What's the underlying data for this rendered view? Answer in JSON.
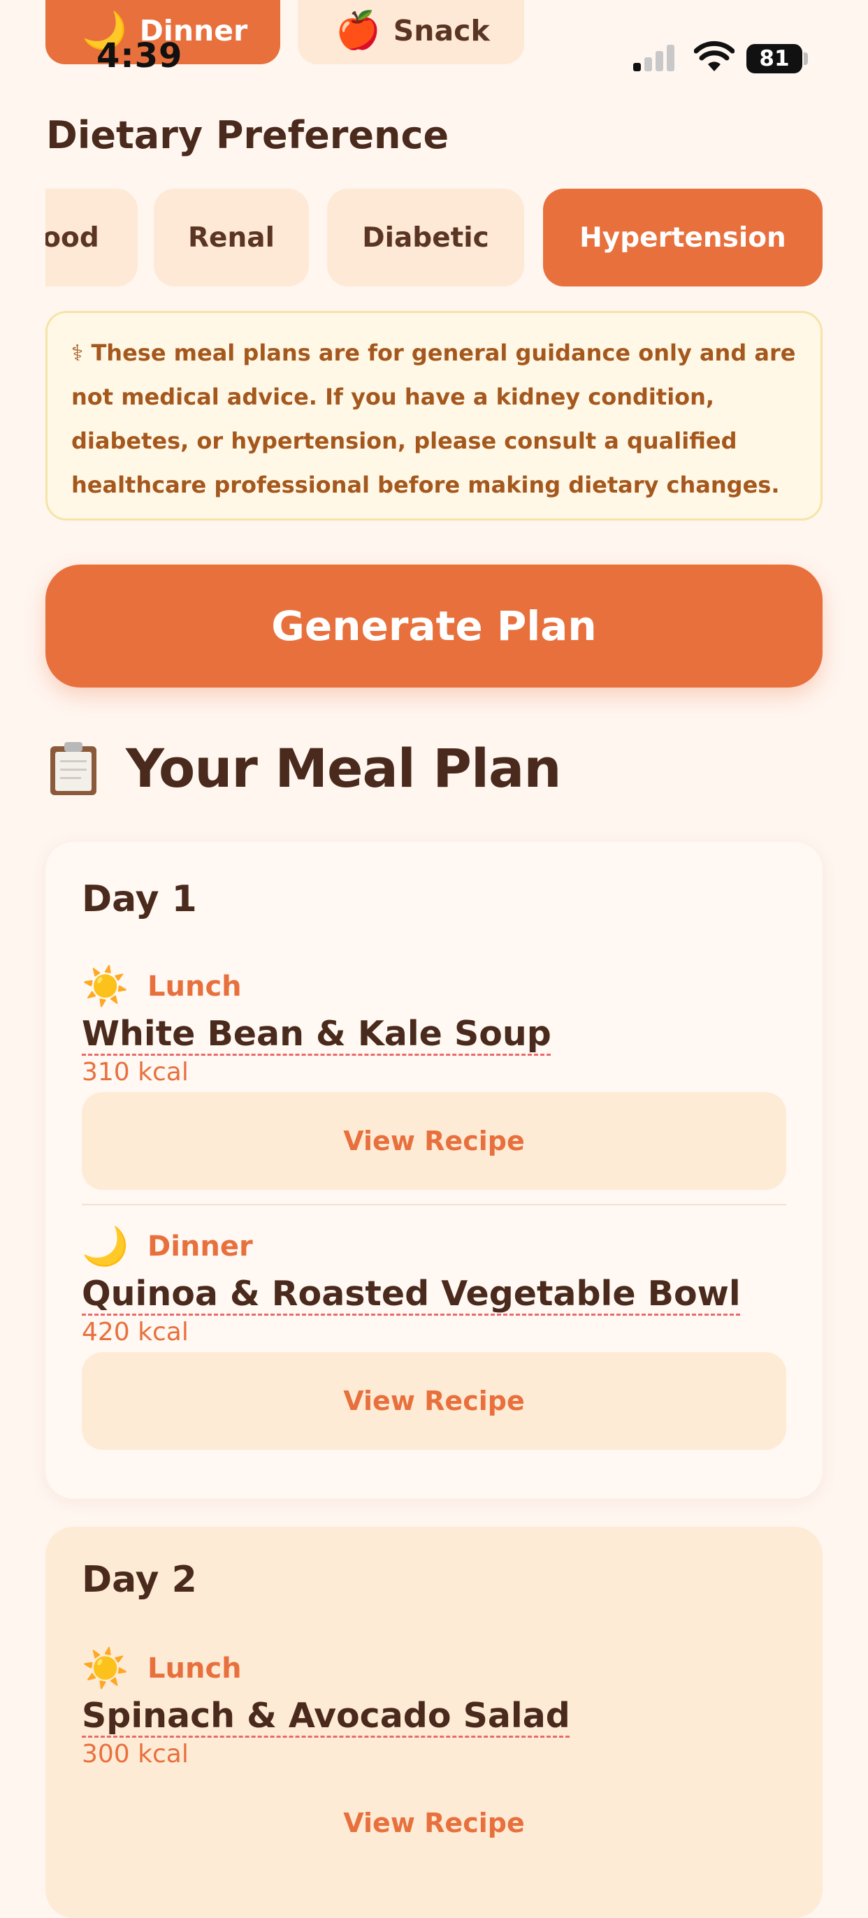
{
  "meal_type_chips": [
    {
      "emoji": "🌙",
      "label": "Dinner",
      "selected": true
    },
    {
      "emoji": "🍎",
      "label": "Snack",
      "selected": false
    }
  ],
  "status_bar": {
    "time": "4:39",
    "battery": "81"
  },
  "dietary": {
    "heading": "Dietary Preference",
    "options": [
      {
        "label": "ood",
        "selected": false
      },
      {
        "label": "Renal",
        "selected": false
      },
      {
        "label": "Diabetic",
        "selected": false
      },
      {
        "label": "Hypertension",
        "selected": true
      }
    ]
  },
  "disclaimer": {
    "lines": [
      "⚕ These meal plans are for general guidance only and are",
      "not medical advice. If you have a kidney condition,",
      "diabetes, or hypertension, please consult a qualified",
      "healthcare professional before making dietary changes."
    ]
  },
  "generate_button": "Generate Plan",
  "plan": {
    "title": "Your Meal Plan",
    "days": [
      {
        "title": "Day 1",
        "meals": [
          {
            "emoji": "☀️",
            "type": "Lunch",
            "name": "White Bean & Kale Soup",
            "kcal": "310 kcal",
            "button": "View Recipe"
          },
          {
            "emoji": "🌙",
            "type": "Dinner",
            "name": "Quinoa & Roasted Vegetable Bowl",
            "kcal": "420 kcal",
            "button": "View Recipe"
          }
        ]
      },
      {
        "title": "Day 2",
        "meals": [
          {
            "emoji": "☀️",
            "type": "Lunch",
            "name": "Spinach & Avocado Salad",
            "kcal": "300 kcal",
            "button": "View Recipe"
          }
        ]
      }
    ]
  },
  "colors": {
    "accent": "#E8703D",
    "chip_bg": "#FEE9D6",
    "background": "#FFF6F0",
    "text": "#4A2A1C"
  }
}
